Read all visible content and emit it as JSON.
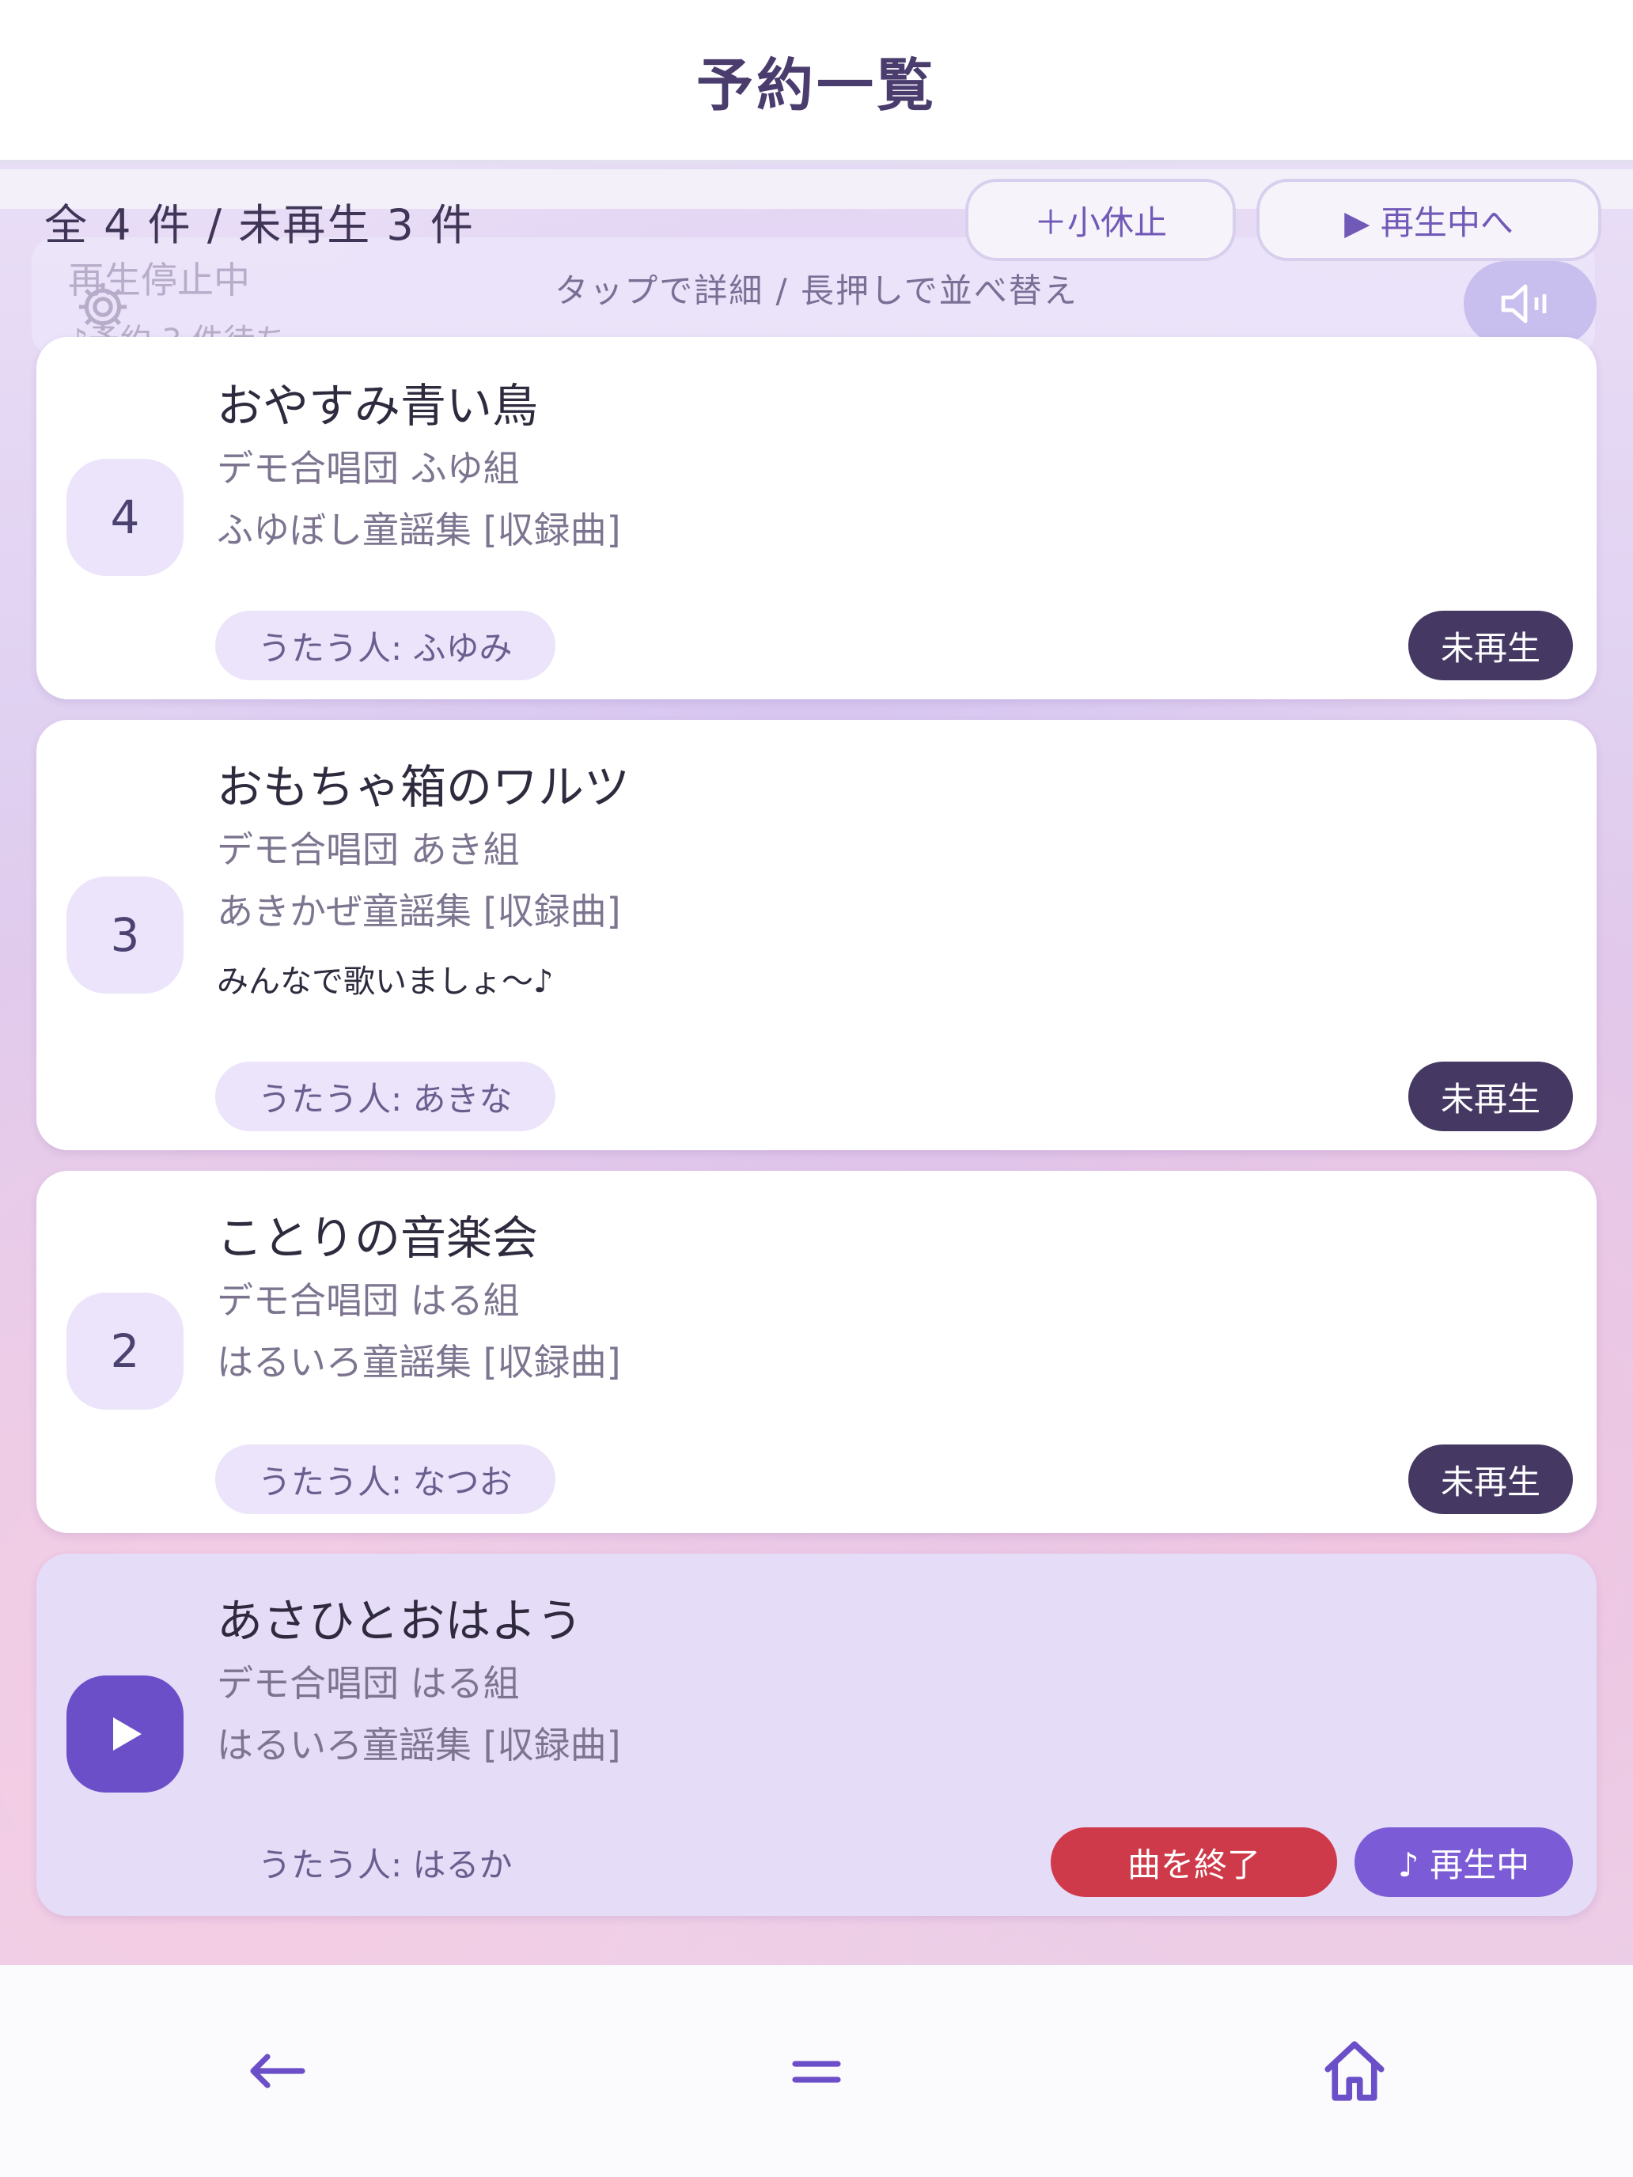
{
  "header": {
    "title": "予約一覧"
  },
  "summary": {
    "counts": "全 4 件 / 未再生 3 件"
  },
  "buttons": {
    "short_break": "＋小休止",
    "to_playing": "▶ 再生中へ"
  },
  "hint": "タップで詳細 / 長押しで並べ替え",
  "player": {
    "status": "再生停止中",
    "queue": "♪予約 3 件待ち"
  },
  "queue": [
    {
      "number": "4",
      "title": "おやすみ青い鳥",
      "group": "デモ合唱団 ふゆ組",
      "album": "ふゆぼし童謡集 [収録曲]",
      "singer": "うたう人: ふゆみ",
      "status": "未再生"
    },
    {
      "number": "3",
      "title": "おもちゃ箱のワルツ",
      "group": "デモ合唱団 あき組",
      "album": "あきかぜ童謡集 [収録曲]",
      "comment": "みんなで歌いましょ〜♪",
      "singer": "うたう人: あきな",
      "status": "未再生"
    },
    {
      "number": "2",
      "title": "ことりの音楽会",
      "group": "デモ合唱団 はる組",
      "album": "はるいろ童謡集 [収録曲]",
      "singer": "うたう人: なつお",
      "status": "未再生"
    }
  ],
  "now_playing": {
    "title": "あさひとおはよう",
    "group": "デモ合唱団 はる組",
    "album": "はるいろ童謡集 [収録曲]",
    "singer": "うたう人: はるか",
    "end_label": "曲を終了",
    "status": "♪ 再生中"
  },
  "nav": {
    "back_icon": "arrow-left-icon",
    "menu_icon": "menu-icon",
    "home_icon": "home-icon"
  },
  "colors": {
    "accent": "#7b5bd6",
    "danger": "#cf3a4a",
    "badge": "#453964",
    "title": "#4a3d6e"
  }
}
